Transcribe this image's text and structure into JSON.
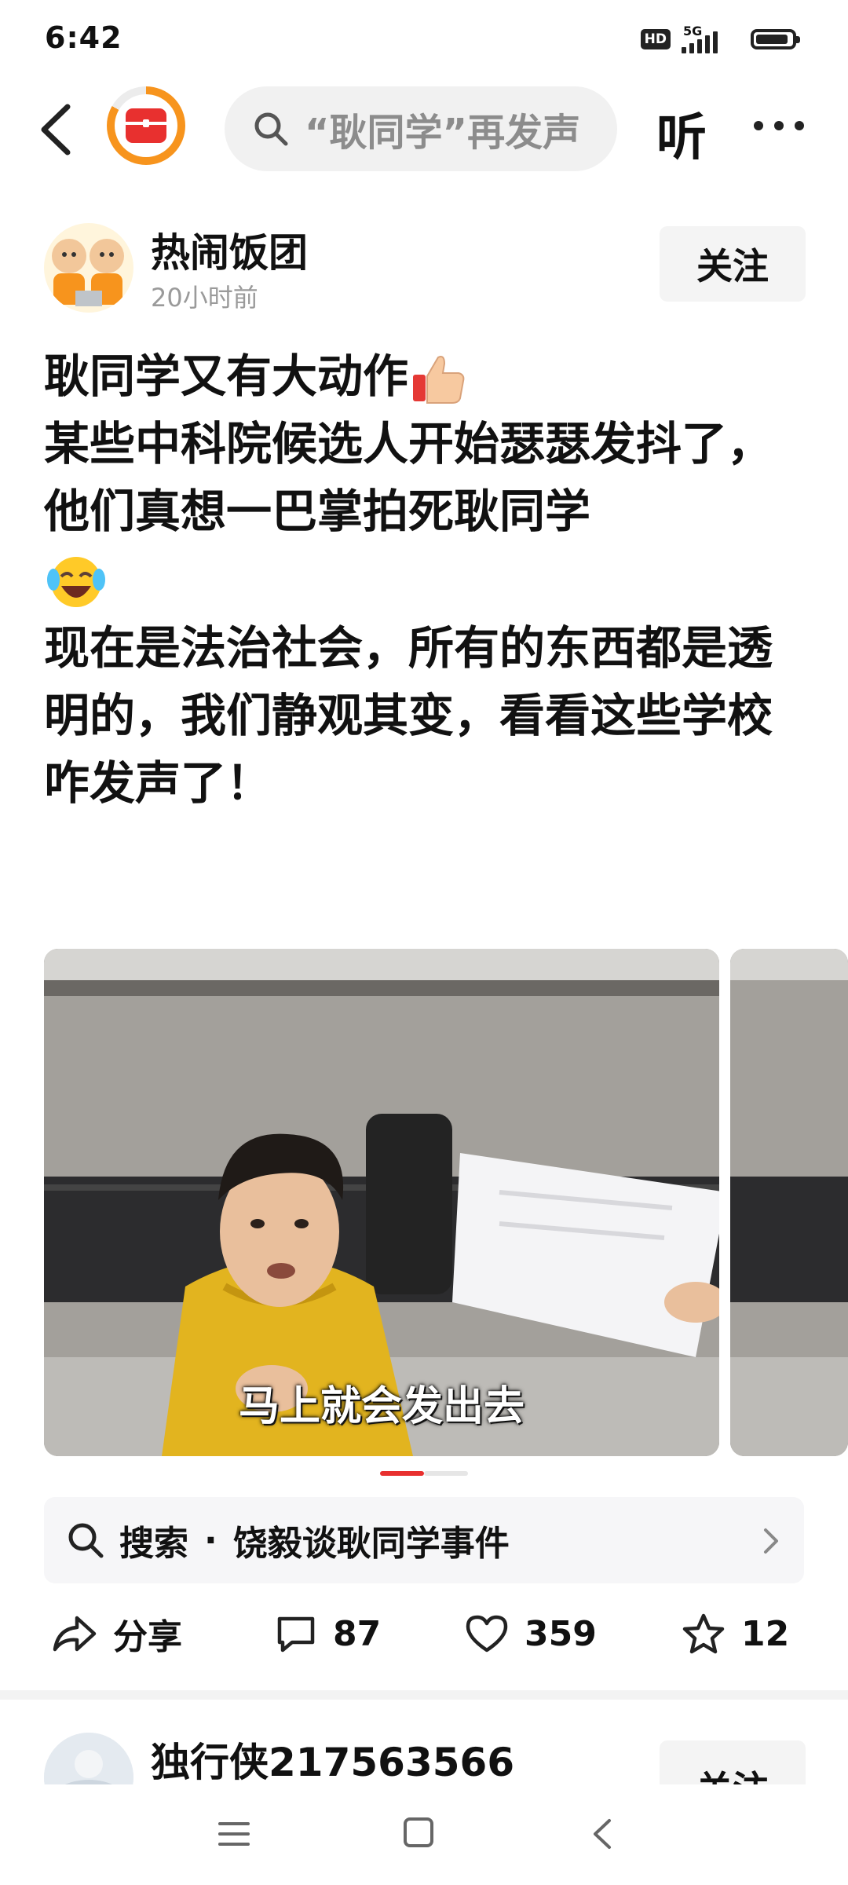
{
  "status_bar": {
    "time": "6:42",
    "hd": "HD",
    "network": "5G",
    "signal_level": 4,
    "battery_level": 0.9
  },
  "app_bar": {
    "search_text": "“耿同学”再发声",
    "listen_label": "听",
    "logo_color": "#e8302f"
  },
  "post": {
    "author": "热闹饭团",
    "time": "20小时前",
    "follow_label": "关注",
    "body": [
      "耿同学又有大动作",
      "某些中科院候选人开始瑟瑟发抖了，他们真想一巴掌拍死耿同学",
      "现在是法治社会，所有的东西都是透明的，我们静观其变，看看这些学校咋发声了！"
    ],
    "emojis": [
      "thumbs-up-icon",
      "laughing-crying-icon"
    ],
    "image_caption": "马上就会发出去",
    "image_count": 2,
    "current_image": 1,
    "related_search_label": "搜索",
    "related_search_separator": "·",
    "related_search_topic": "饶毅谈耿同学事件",
    "actions": {
      "share_label": "分享",
      "comments": "87",
      "likes": "359",
      "favorites": "12"
    }
  },
  "next_post": {
    "author": "独行侠217563566",
    "follow_label": "关注"
  },
  "colors": {
    "accent": "#e8302f",
    "logo_ring": "#f7941d",
    "muted_text": "#9a9a9a"
  }
}
